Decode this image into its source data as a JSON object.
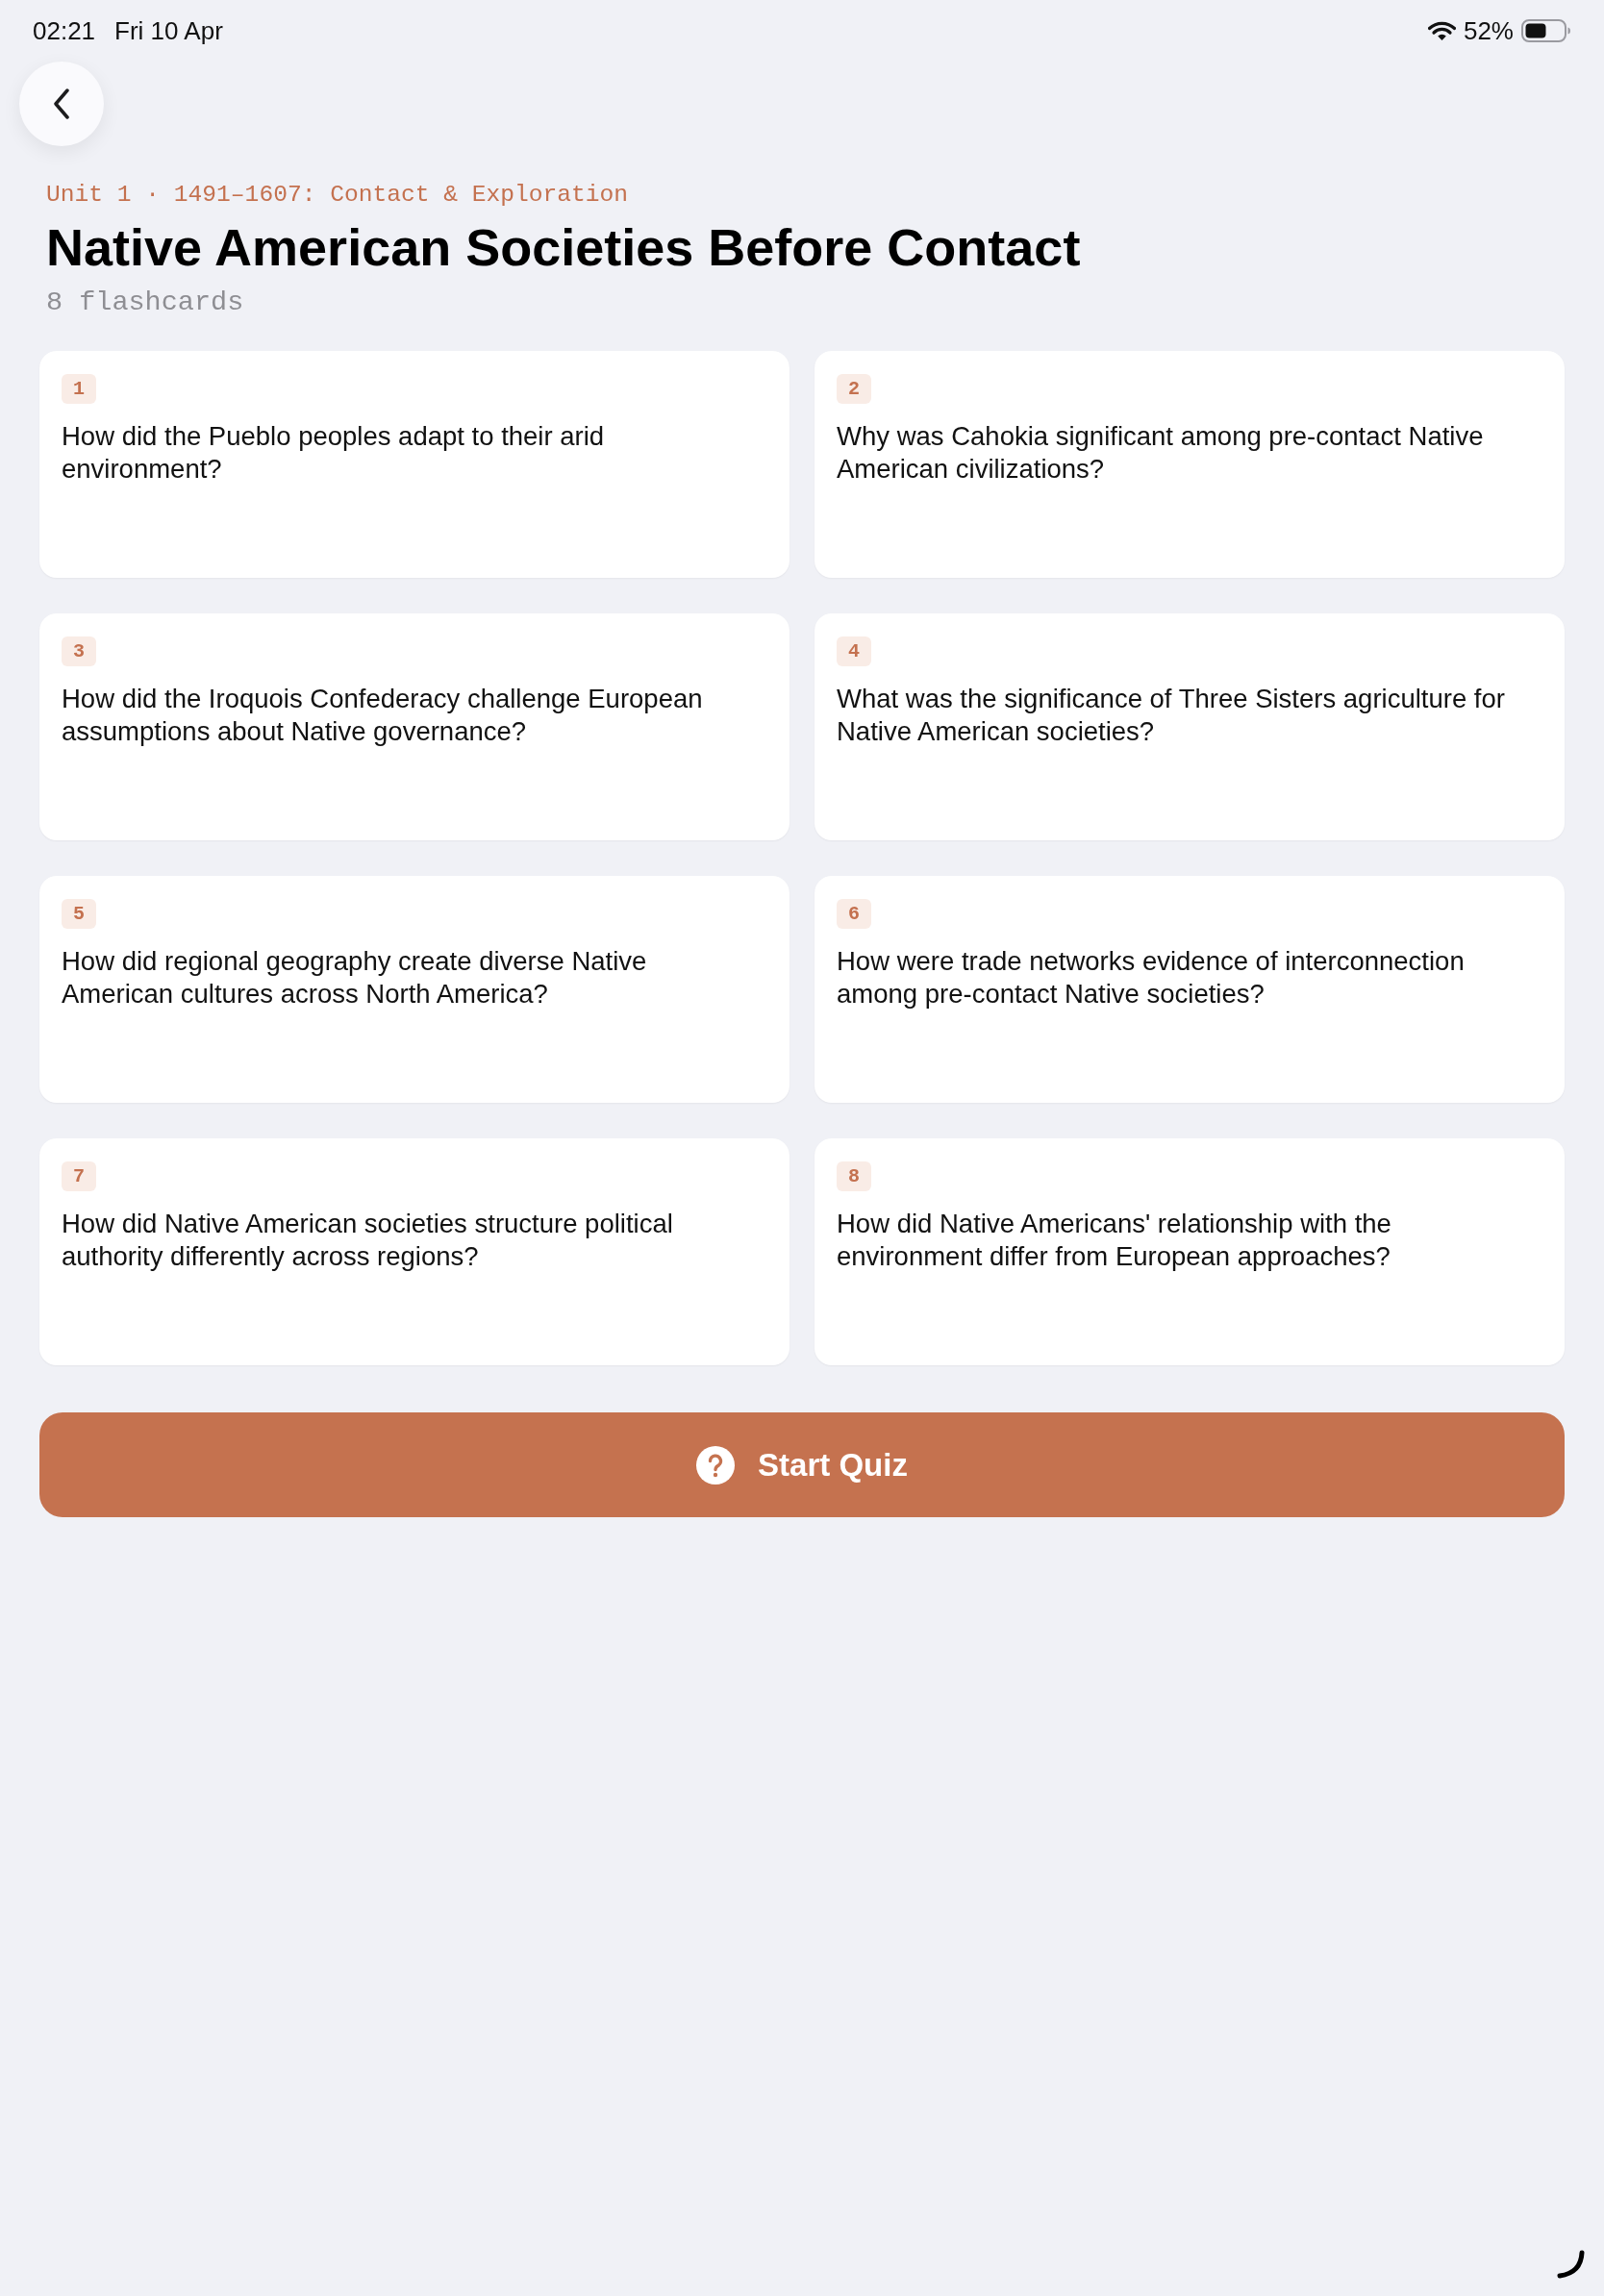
{
  "status_bar": {
    "time": "02:21",
    "date": "Fri 10 Apr",
    "battery": "52%"
  },
  "header": {
    "breadcrumb": "Unit 1 · 1491–1607: Contact & Exploration",
    "title": "Native American Societies Before Contact",
    "card_count": "8 flashcards"
  },
  "flashcards": [
    {
      "number": "1",
      "question": "How did the Pueblo peoples adapt to their arid environment?"
    },
    {
      "number": "2",
      "question": "Why was Cahokia significant among pre-contact Native American civilizations?"
    },
    {
      "number": "3",
      "question": "How did the Iroquois Confederacy challenge European assumptions about Native governance?"
    },
    {
      "number": "4",
      "question": "What was the significance of Three Sisters agriculture for Native American societies?"
    },
    {
      "number": "5",
      "question": "How did regional geography create diverse Native American cultures across North America?"
    },
    {
      "number": "6",
      "question": "How were trade networks evidence of interconnection among pre-contact Native societies?"
    },
    {
      "number": "7",
      "question": "How did Native American societies structure political authority differently across regions?"
    },
    {
      "number": "8",
      "question": "How did Native Americans' relationship with the environment differ from European approaches?"
    }
  ],
  "start_button": {
    "label": "Start Quiz"
  }
}
